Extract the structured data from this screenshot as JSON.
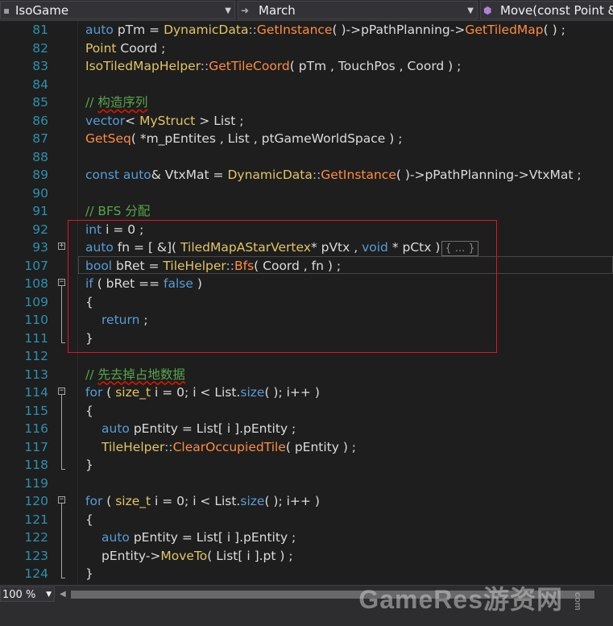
{
  "navbar": {
    "project": "IsoGame",
    "scope": "March",
    "member": "Move(const Point &"
  },
  "colors": {
    "keyword": "#569cd6",
    "type": "#e2c564",
    "function": "#ff8c40",
    "comment": "#57a64a",
    "line_number": "#2b91af",
    "highlight_box": "#e81123"
  },
  "editor": {
    "lines": [
      {
        "n": "81",
        "t": [
          [
            "  ",
            "sp"
          ],
          [
            "auto",
            "kw"
          ],
          [
            " pTm = ",
            "tx"
          ],
          [
            "DynamicData",
            "ty"
          ],
          [
            "::",
            "op"
          ],
          [
            "GetInstance",
            "fn"
          ],
          [
            "( )->pPathPlanning->",
            "tx"
          ],
          [
            "GetTiledMap",
            "fn"
          ],
          [
            "( ) ;",
            "tx"
          ]
        ]
      },
      {
        "n": "82",
        "t": [
          [
            "  ",
            "sp"
          ],
          [
            "Point",
            "ty"
          ],
          [
            " Coord ;",
            "tx"
          ]
        ]
      },
      {
        "n": "83",
        "t": [
          [
            "  ",
            "sp"
          ],
          [
            "IsoTiledMapHelper",
            "ty"
          ],
          [
            "::",
            "op"
          ],
          [
            "GetTileCoord",
            "fn"
          ],
          [
            "( pTm , TouchPos , Coord ) ;",
            "tx"
          ]
        ]
      },
      {
        "n": "84",
        "t": []
      },
      {
        "n": "85",
        "t": [
          [
            "  ",
            "sp"
          ],
          [
            "// ",
            "cm"
          ],
          [
            "构造序列",
            "cmsq"
          ]
        ]
      },
      {
        "n": "86",
        "t": [
          [
            "  ",
            "sp"
          ],
          [
            "vector",
            "kw"
          ],
          [
            "< ",
            "tx"
          ],
          [
            "MyStruct",
            "ty"
          ],
          [
            " > List ;",
            "tx"
          ]
        ]
      },
      {
        "n": "87",
        "t": [
          [
            "  ",
            "sp"
          ],
          [
            "GetSeq",
            "fn"
          ],
          [
            "( *m_pEntites , List , ptGameWorldSpace ) ;",
            "tx"
          ]
        ]
      },
      {
        "n": "88",
        "t": []
      },
      {
        "n": "89",
        "t": [
          [
            "  ",
            "sp"
          ],
          [
            "const auto",
            "kw"
          ],
          [
            "& VtxMat = ",
            "tx"
          ],
          [
            "DynamicData",
            "ty"
          ],
          [
            "::",
            "op"
          ],
          [
            "GetInstance",
            "fn"
          ],
          [
            "( )->pPathPlanning->VtxMat ;",
            "tx"
          ]
        ]
      },
      {
        "n": "90",
        "t": []
      },
      {
        "n": "91",
        "t": [
          [
            "  ",
            "sp"
          ],
          [
            "// BFS 分配",
            "cm"
          ]
        ]
      },
      {
        "n": "92",
        "t": [
          [
            "  ",
            "sp"
          ],
          [
            "int",
            "kw"
          ],
          [
            " i = 0 ;",
            "tx"
          ]
        ]
      },
      {
        "n": "93",
        "t": [
          [
            "  ",
            "sp"
          ],
          [
            "auto",
            "kw"
          ],
          [
            " fn = [ &]( ",
            "tx"
          ],
          [
            "TiledMapAStarVertex",
            "ty"
          ],
          [
            "* pVtx , ",
            "tx"
          ],
          [
            "void",
            "kw"
          ],
          [
            " * pCtx )",
            "tx"
          ],
          [
            "{ ... }",
            "col"
          ]
        ]
      },
      {
        "n": "107",
        "t": [
          [
            "  ",
            "sp"
          ],
          [
            "bool",
            "kw"
          ],
          [
            " bRet = ",
            "tx"
          ],
          [
            "TileHelper",
            "ty"
          ],
          [
            "::",
            "op"
          ],
          [
            "Bfs",
            "fn"
          ],
          [
            "( Coord , fn ) ;",
            "tx"
          ]
        ]
      },
      {
        "n": "108",
        "t": [
          [
            "  ",
            "sp"
          ],
          [
            "if",
            "kw"
          ],
          [
            " ( bRet == ",
            "tx"
          ],
          [
            "false",
            "kw"
          ],
          [
            " )",
            "tx"
          ]
        ]
      },
      {
        "n": "109",
        "t": [
          [
            "  ",
            "sp"
          ],
          [
            "{",
            "tx"
          ]
        ]
      },
      {
        "n": "110",
        "t": [
          [
            "      ",
            "sp"
          ],
          [
            "return",
            "kw"
          ],
          [
            " ;",
            "tx"
          ]
        ]
      },
      {
        "n": "111",
        "t": [
          [
            "  ",
            "sp"
          ],
          [
            "}",
            "tx"
          ]
        ]
      },
      {
        "n": "112",
        "t": []
      },
      {
        "n": "113",
        "t": [
          [
            "  ",
            "sp"
          ],
          [
            "// ",
            "cm"
          ],
          [
            "先去掉占地数据",
            "cmsq"
          ]
        ]
      },
      {
        "n": "114",
        "t": [
          [
            "  ",
            "sp"
          ],
          [
            "for",
            "kw"
          ],
          [
            " ( ",
            "tx"
          ],
          [
            "size_t",
            "ty"
          ],
          [
            " i = 0; i < List.",
            "tx"
          ],
          [
            "size",
            "kw"
          ],
          [
            "( ); i++ )",
            "tx"
          ]
        ]
      },
      {
        "n": "115",
        "t": [
          [
            "  ",
            "sp"
          ],
          [
            "{",
            "tx"
          ]
        ]
      },
      {
        "n": "116",
        "t": [
          [
            "      ",
            "sp"
          ],
          [
            "auto",
            "kw"
          ],
          [
            " pEntity = List[ i ].pEntity ;",
            "tx"
          ]
        ]
      },
      {
        "n": "117",
        "t": [
          [
            "      ",
            "sp"
          ],
          [
            "TileHelper",
            "ty"
          ],
          [
            "::",
            "op"
          ],
          [
            "ClearOccupiedTile",
            "fn"
          ],
          [
            "( pEntity ) ;",
            "tx"
          ]
        ]
      },
      {
        "n": "118",
        "t": [
          [
            "  ",
            "sp"
          ],
          [
            "}",
            "tx"
          ]
        ]
      },
      {
        "n": "119",
        "t": []
      },
      {
        "n": "120",
        "t": [
          [
            "  ",
            "sp"
          ],
          [
            "for",
            "kw"
          ],
          [
            " ( ",
            "tx"
          ],
          [
            "size_t",
            "ty"
          ],
          [
            " i = 0; i < List.",
            "tx"
          ],
          [
            "size",
            "kw"
          ],
          [
            "( ); i++ )",
            "tx"
          ]
        ]
      },
      {
        "n": "121",
        "t": [
          [
            "  ",
            "sp"
          ],
          [
            "{",
            "tx"
          ]
        ]
      },
      {
        "n": "122",
        "t": [
          [
            "      ",
            "sp"
          ],
          [
            "auto",
            "kw"
          ],
          [
            " pEntity = List[ i ].pEntity ;",
            "tx"
          ]
        ]
      },
      {
        "n": "123",
        "t": [
          [
            "      ",
            "sp"
          ],
          [
            "pEntity->",
            "tx"
          ],
          [
            "MoveTo",
            "ty"
          ],
          [
            "( List[ i ].pt ) ;",
            "tx"
          ]
        ]
      },
      {
        "n": "124",
        "t": [
          [
            "  ",
            "sp"
          ],
          [
            "}",
            "tx"
          ]
        ]
      }
    ],
    "fold_markers": [
      "93",
      "108",
      "114",
      "120"
    ]
  },
  "statusbar": {
    "zoom": "100 %"
  },
  "watermark": {
    "text": "GameRes游资网",
    "suffix": "com"
  }
}
